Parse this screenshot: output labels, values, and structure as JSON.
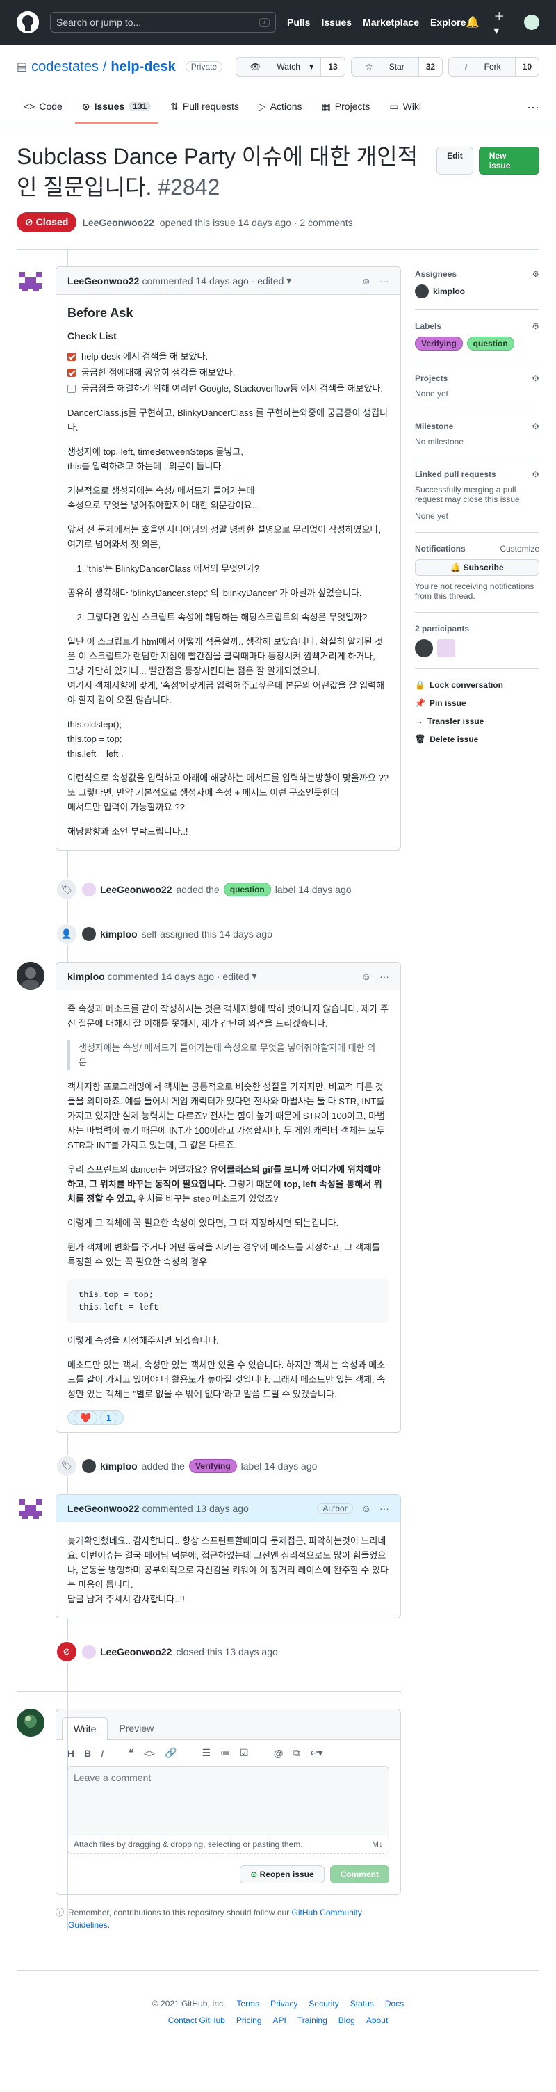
{
  "nav": {
    "search_placeholder": "Search or jump to...",
    "search_shortcut": "/",
    "links": [
      "Pulls",
      "Issues",
      "Marketplace",
      "Explore"
    ]
  },
  "repo": {
    "owner": "codestates",
    "sep": "/",
    "name": "help-desk",
    "visibility": "Private",
    "watch_label": "Watch",
    "watch_count": "13",
    "star_label": "Star",
    "star_count": "32",
    "fork_label": "Fork",
    "fork_count": "10"
  },
  "tabs": [
    {
      "label": "Code"
    },
    {
      "label": "Issues",
      "count": "131"
    },
    {
      "label": "Pull requests"
    },
    {
      "label": "Actions"
    },
    {
      "label": "Projects"
    },
    {
      "label": "Wiki"
    }
  ],
  "issue": {
    "title": "Subclass Dance Party 이슈에 대한 개인적인 질문입니다.",
    "number": "#2842",
    "edit_label": "Edit",
    "new_issue_label": "New issue",
    "state": "Closed",
    "author": "LeeGeonwoo22",
    "meta_text": "opened this issue 14 days ago · 2 comments"
  },
  "comment1": {
    "author": "LeeGeonwoo22",
    "meta": "commented 14 days ago · edited",
    "heading": "Before Ask",
    "subheading": "Check List",
    "tasks": [
      {
        "text": "help-desk 에서 검색을 해 보았다.",
        "checked": true
      },
      {
        "text": "궁금한 점에대해 공유히 생각을 해보았다.",
        "checked": true
      },
      {
        "text": "궁금점을 해결하기 위해 여러번 Google, Stackoverflow등 에서 검색을 해보았다.",
        "checked": false
      }
    ],
    "p1": "DancerClass.js를 구현하고, BlinkyDancerClass 를 구현하는와중에 궁금증이 생깁니다.",
    "p2a": "생성자에 top, left, timeBetweenSteps 를넣고,",
    "p2b": "this를 입력하려고 하는데 , 의문이 듭니다.",
    "p3a": "기본적으로 생성자에는 속성/ 메서드가 들어가는데",
    "p3b": "속성으로 무엇을 넣어줘야할지에 대한 의문감이요..",
    "p4a": "앞서 전 문제에서는 호올엔지니어님의 정말 명쾌한 설명으로 무리없이 작성하였으나,",
    "p4b": "여기로 넘어와서 첫 의문,",
    "q1": "'this'는 BlinkyDancerClass 에서의 무엇인가?",
    "p5": "공유히 생각해다 'blinkyDancer.step;' 의 'blinkyDancer' 가 아닐까 싶었습니다.",
    "q2": "그렇다면 앞선 스크립트 속성에 해당하는 해당스크립트의 속성은 무엇일까?",
    "p6a": "일단 이 스크립트가 html에서 어떻게 적용할까.. 생각해 보았습니다. 확실히 알게된 것은 이 스크립트가 랜덤한 지점에 빨간점을 클릭때마다 등장시켜 깜빡거리게 하거나,",
    "p6b": "그냥 가만히 있거나... 빨간점을 등장시킨다는 점은 잘 알게되었으나,",
    "p6c": "여기서 객체지향에 맞게, '속성'에맞게끔 입력해주고싶은데 본문의 어떤값을 잘 입력해야 할지 감이 오질 않습니다.",
    "code1": "this.oldstep();",
    "code2": "this.top = top;",
    "code3": "this.left = left .",
    "p7a": "이런식으로 속성값을 입력하고 아래에 해당하는 메서드를 입력하는방향이 맞을까요 ??",
    "p7b": "또 그렇다면, 만약 기본적으로 생성자에 속성 + 메서드 이런 구조인듯한데",
    "p7c": "메서드만 입력이 가능할까요 ??",
    "p8": "해당방향과 조언 부탁드립니다..!"
  },
  "event1": {
    "author": "LeeGeonwoo22",
    "action": "added the",
    "label": "question",
    "suffix": "label 14 days ago"
  },
  "event2": {
    "author": "kimploo",
    "action": "self-assigned this 14 days ago"
  },
  "comment2": {
    "author": "kimploo",
    "meta": "commented 14 days ago · edited",
    "p1": "즉 속성과 메소드를 같이 작성하시는 것은 객체지향에 딱히 벗어나지 않습니다. 제가 주신 질문에 대해서 잘 이해를 못해서, 제가 간단히 의견을 드리겠습니다.",
    "quote": "생성자에는 속성/ 메서드가 들어가는데 속성으로 무엇을 넣어줘야할지에 대한 의문",
    "p2": "객체지향 프로그래밍에서 객체는 공통적으로 비슷한 성질을 가지지만, 비교적 다른 것들을 의미하죠. 예를 들어서 게임 캐릭터가 있다면 전사와 마법사는 둘 다 STR, INT를 가지고 있지만 실제 능력치는 다르죠? 전사는 힘이 높기 때문에 STR이 100이고, 마법사는 마법력이 높기 때문에 INT가 100이라고 가정합시다. 두 게임 캐릭터 객체는 모두 STR과 INT를 가지고 있는데, 그 값은 다르죠.",
    "p3a": "우리 스프린트의 dancer는 어떨까요? ",
    "p3b": "유어클래스의 gif를 보니까 어디가에 위치해야 하고, 그 위치를 바꾸는 동작이 필요합니다.",
    "p3c": " 그렇기 때문에 ",
    "p3d": "top, left 속성을 통해서 위치를 정할 수 있고,",
    "p3e": " 위치를 바꾸는 step 메소드가 있었죠?",
    "p4": "이렇게 그 객체에 꼭 필요한 속성이 있다면, 그 때 지정하시면 되는겁니다.",
    "p5": "뭔가 객체에 변화를 주거나 어떤 동작을 시키는 경우에 메소드를 지정하고, 그 객체를 특정할 수 있는 꼭 필요한 속성의 경우",
    "code1": "this.top = top;",
    "code2": "this.left = left",
    "p6": "이렇게 속성을 지정해주시면 되겠습니다.",
    "p7": "메소드만 있는 객체, 속성만 있는 객체만 있을 수 있습니다. 하지만 객체는 속성과 메소드를 같이 가지고 있어야 더 활용도가 높아질 것입니다. 그래서 메소드만 있는 객체, 속성만 있는 객체는 \"별로 없을 수 밖에 없다\"라고 말씀 드릴 수 있겠습니다.",
    "reaction_icon": "heart-icon",
    "reaction_count": "1"
  },
  "event3": {
    "author": "kimploo",
    "action": "added the",
    "label": "Verifying",
    "suffix": "label 14 days ago"
  },
  "comment3": {
    "author": "LeeGeonwoo22",
    "meta": "commented 13 days ago",
    "role": "Author",
    "p1": "늦게확인했네요.. 감사합니다.. 항상 스프린트할때마다 문제접근, 파악하는것이 느리네요. 이번이슈는 결국 페어님 덕분에, 접근하였는데 그전엔 심리적으로도 많이 힘들었으나, 운동을 병행하며 공부외적으로 자신감을 키워야 이 장거리 레이스에 완주할 수 있다는 마음이 듭니다.",
    "p2": "답글 남겨 주셔서 감사합니다..!!"
  },
  "event4": {
    "author": "LeeGeonwoo22",
    "action": "closed this 13 days ago"
  },
  "sidebar": {
    "assignees_label": "Assignees",
    "assignee": "kimploo",
    "labels_label": "Labels",
    "labels": [
      "Verifying",
      "question"
    ],
    "projects_label": "Projects",
    "projects_val": "None yet",
    "milestone_label": "Milestone",
    "milestone_val": "No milestone",
    "linked_label": "Linked pull requests",
    "linked_desc": "Successfully merging a pull request may close this issue.",
    "linked_val": "None yet",
    "notif_label": "Notifications",
    "notif_customize": "Customize",
    "subscribe_label": "Subscribe",
    "notif_desc": "You're not receiving notifications from this thread.",
    "participants_label": "2 participants",
    "lock_label": "Lock conversation",
    "pin_label": "Pin issue",
    "transfer_label": "Transfer issue",
    "delete_label": "Delete issue"
  },
  "composer": {
    "tab_write": "Write",
    "tab_preview": "Preview",
    "placeholder": "Leave a comment",
    "attach_text": "Attach files by dragging & dropping, selecting or pasting them.",
    "reopen_label": "Reopen issue",
    "comment_label": "Comment",
    "remember_text": "Remember, contributions to this repository should follow our",
    "remember_link": "GitHub Community Guidelines",
    "remember_end": "."
  },
  "footer": {
    "copyright": "© 2021 GitHub, Inc.",
    "row1": [
      "Terms",
      "Privacy",
      "Security",
      "Status",
      "Docs"
    ],
    "row2": [
      "Contact GitHub",
      "Pricing",
      "API",
      "Training",
      "Blog",
      "About"
    ]
  },
  "colors": {
    "closed": "#cf222e",
    "new_issue": "#2da44e",
    "label_question": "#7ee29a",
    "label_verifying": "#c673d8",
    "tab_underline": "#fd8c73"
  }
}
